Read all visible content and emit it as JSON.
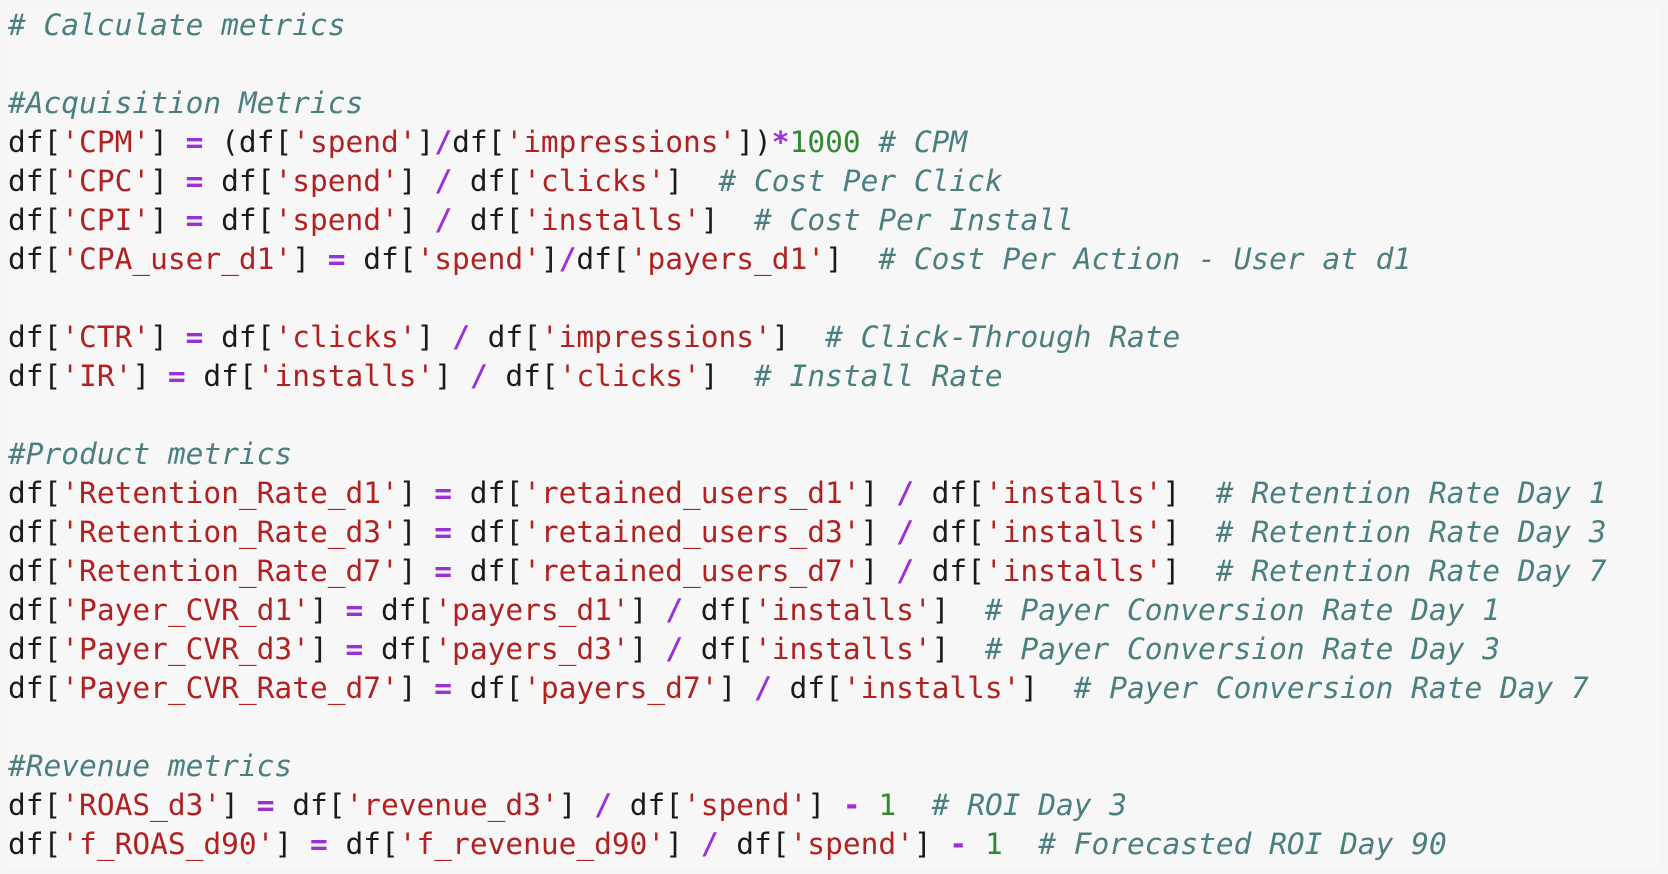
{
  "colors": {
    "background": "#f7f7f7",
    "plain": "#1a1a1a",
    "string": "#b22121",
    "operator": "#9d2fd6",
    "number": "#2f8a2f",
    "comment": "#4b7f7f"
  },
  "code_lines": [
    [
      {
        "t": "comment",
        "v": "# Calculate metrics"
      }
    ],
    [],
    [
      {
        "t": "comment",
        "v": "#Acquisition Metrics"
      }
    ],
    [
      {
        "t": "plain",
        "v": "df["
      },
      {
        "t": "str",
        "v": "'CPM'"
      },
      {
        "t": "plain",
        "v": "] "
      },
      {
        "t": "op",
        "v": "="
      },
      {
        "t": "plain",
        "v": " (df["
      },
      {
        "t": "str",
        "v": "'spend'"
      },
      {
        "t": "plain",
        "v": "]"
      },
      {
        "t": "op",
        "v": "/"
      },
      {
        "t": "plain",
        "v": "df["
      },
      {
        "t": "str",
        "v": "'impressions'"
      },
      {
        "t": "plain",
        "v": "])"
      },
      {
        "t": "op",
        "v": "*"
      },
      {
        "t": "num",
        "v": "1000"
      },
      {
        "t": "plain",
        "v": " "
      },
      {
        "t": "comment",
        "v": "# CPM"
      }
    ],
    [
      {
        "t": "plain",
        "v": "df["
      },
      {
        "t": "str",
        "v": "'CPC'"
      },
      {
        "t": "plain",
        "v": "] "
      },
      {
        "t": "op",
        "v": "="
      },
      {
        "t": "plain",
        "v": " df["
      },
      {
        "t": "str",
        "v": "'spend'"
      },
      {
        "t": "plain",
        "v": "] "
      },
      {
        "t": "op",
        "v": "/"
      },
      {
        "t": "plain",
        "v": " df["
      },
      {
        "t": "str",
        "v": "'clicks'"
      },
      {
        "t": "plain",
        "v": "]  "
      },
      {
        "t": "comment",
        "v": "# Cost Per Click"
      }
    ],
    [
      {
        "t": "plain",
        "v": "df["
      },
      {
        "t": "str",
        "v": "'CPI'"
      },
      {
        "t": "plain",
        "v": "] "
      },
      {
        "t": "op",
        "v": "="
      },
      {
        "t": "plain",
        "v": " df["
      },
      {
        "t": "str",
        "v": "'spend'"
      },
      {
        "t": "plain",
        "v": "] "
      },
      {
        "t": "op",
        "v": "/"
      },
      {
        "t": "plain",
        "v": " df["
      },
      {
        "t": "str",
        "v": "'installs'"
      },
      {
        "t": "plain",
        "v": "]  "
      },
      {
        "t": "comment",
        "v": "# Cost Per Install"
      }
    ],
    [
      {
        "t": "plain",
        "v": "df["
      },
      {
        "t": "str",
        "v": "'CPA_user_d1'"
      },
      {
        "t": "plain",
        "v": "] "
      },
      {
        "t": "op",
        "v": "="
      },
      {
        "t": "plain",
        "v": " df["
      },
      {
        "t": "str",
        "v": "'spend'"
      },
      {
        "t": "plain",
        "v": "]"
      },
      {
        "t": "op",
        "v": "/"
      },
      {
        "t": "plain",
        "v": "df["
      },
      {
        "t": "str",
        "v": "'payers_d1'"
      },
      {
        "t": "plain",
        "v": "]  "
      },
      {
        "t": "comment",
        "v": "# Cost Per Action - User at d1"
      }
    ],
    [],
    [
      {
        "t": "plain",
        "v": "df["
      },
      {
        "t": "str",
        "v": "'CTR'"
      },
      {
        "t": "plain",
        "v": "] "
      },
      {
        "t": "op",
        "v": "="
      },
      {
        "t": "plain",
        "v": " df["
      },
      {
        "t": "str",
        "v": "'clicks'"
      },
      {
        "t": "plain",
        "v": "] "
      },
      {
        "t": "op",
        "v": "/"
      },
      {
        "t": "plain",
        "v": " df["
      },
      {
        "t": "str",
        "v": "'impressions'"
      },
      {
        "t": "plain",
        "v": "]  "
      },
      {
        "t": "comment",
        "v": "# Click-Through Rate"
      }
    ],
    [
      {
        "t": "plain",
        "v": "df["
      },
      {
        "t": "str",
        "v": "'IR'"
      },
      {
        "t": "plain",
        "v": "] "
      },
      {
        "t": "op",
        "v": "="
      },
      {
        "t": "plain",
        "v": " df["
      },
      {
        "t": "str",
        "v": "'installs'"
      },
      {
        "t": "plain",
        "v": "] "
      },
      {
        "t": "op",
        "v": "/"
      },
      {
        "t": "plain",
        "v": " df["
      },
      {
        "t": "str",
        "v": "'clicks'"
      },
      {
        "t": "plain",
        "v": "]  "
      },
      {
        "t": "comment",
        "v": "# Install Rate"
      }
    ],
    [],
    [
      {
        "t": "comment",
        "v": "#Product metrics"
      }
    ],
    [
      {
        "t": "plain",
        "v": "df["
      },
      {
        "t": "str",
        "v": "'Retention_Rate_d1'"
      },
      {
        "t": "plain",
        "v": "] "
      },
      {
        "t": "op",
        "v": "="
      },
      {
        "t": "plain",
        "v": " df["
      },
      {
        "t": "str",
        "v": "'retained_users_d1'"
      },
      {
        "t": "plain",
        "v": "] "
      },
      {
        "t": "op",
        "v": "/"
      },
      {
        "t": "plain",
        "v": " df["
      },
      {
        "t": "str",
        "v": "'installs'"
      },
      {
        "t": "plain",
        "v": "]  "
      },
      {
        "t": "comment",
        "v": "# Retention Rate Day 1"
      }
    ],
    [
      {
        "t": "plain",
        "v": "df["
      },
      {
        "t": "str",
        "v": "'Retention_Rate_d3'"
      },
      {
        "t": "plain",
        "v": "] "
      },
      {
        "t": "op",
        "v": "="
      },
      {
        "t": "plain",
        "v": " df["
      },
      {
        "t": "str",
        "v": "'retained_users_d3'"
      },
      {
        "t": "plain",
        "v": "] "
      },
      {
        "t": "op",
        "v": "/"
      },
      {
        "t": "plain",
        "v": " df["
      },
      {
        "t": "str",
        "v": "'installs'"
      },
      {
        "t": "plain",
        "v": "]  "
      },
      {
        "t": "comment",
        "v": "# Retention Rate Day 3"
      }
    ],
    [
      {
        "t": "plain",
        "v": "df["
      },
      {
        "t": "str",
        "v": "'Retention_Rate_d7'"
      },
      {
        "t": "plain",
        "v": "] "
      },
      {
        "t": "op",
        "v": "="
      },
      {
        "t": "plain",
        "v": " df["
      },
      {
        "t": "str",
        "v": "'retained_users_d7'"
      },
      {
        "t": "plain",
        "v": "] "
      },
      {
        "t": "op",
        "v": "/"
      },
      {
        "t": "plain",
        "v": " df["
      },
      {
        "t": "str",
        "v": "'installs'"
      },
      {
        "t": "plain",
        "v": "]  "
      },
      {
        "t": "comment",
        "v": "# Retention Rate Day 7"
      }
    ],
    [
      {
        "t": "plain",
        "v": "df["
      },
      {
        "t": "str",
        "v": "'Payer_CVR_d1'"
      },
      {
        "t": "plain",
        "v": "] "
      },
      {
        "t": "op",
        "v": "="
      },
      {
        "t": "plain",
        "v": " df["
      },
      {
        "t": "str",
        "v": "'payers_d1'"
      },
      {
        "t": "plain",
        "v": "] "
      },
      {
        "t": "op",
        "v": "/"
      },
      {
        "t": "plain",
        "v": " df["
      },
      {
        "t": "str",
        "v": "'installs'"
      },
      {
        "t": "plain",
        "v": "]  "
      },
      {
        "t": "comment",
        "v": "# Payer Conversion Rate Day 1"
      }
    ],
    [
      {
        "t": "plain",
        "v": "df["
      },
      {
        "t": "str",
        "v": "'Payer_CVR_d3'"
      },
      {
        "t": "plain",
        "v": "] "
      },
      {
        "t": "op",
        "v": "="
      },
      {
        "t": "plain",
        "v": " df["
      },
      {
        "t": "str",
        "v": "'payers_d3'"
      },
      {
        "t": "plain",
        "v": "] "
      },
      {
        "t": "op",
        "v": "/"
      },
      {
        "t": "plain",
        "v": " df["
      },
      {
        "t": "str",
        "v": "'installs'"
      },
      {
        "t": "plain",
        "v": "]  "
      },
      {
        "t": "comment",
        "v": "# Payer Conversion Rate Day 3"
      }
    ],
    [
      {
        "t": "plain",
        "v": "df["
      },
      {
        "t": "str",
        "v": "'Payer_CVR_Rate_d7'"
      },
      {
        "t": "plain",
        "v": "] "
      },
      {
        "t": "op",
        "v": "="
      },
      {
        "t": "plain",
        "v": " df["
      },
      {
        "t": "str",
        "v": "'payers_d7'"
      },
      {
        "t": "plain",
        "v": "] "
      },
      {
        "t": "op",
        "v": "/"
      },
      {
        "t": "plain",
        "v": " df["
      },
      {
        "t": "str",
        "v": "'installs'"
      },
      {
        "t": "plain",
        "v": "]  "
      },
      {
        "t": "comment",
        "v": "# Payer Conversion Rate Day 7"
      }
    ],
    [],
    [
      {
        "t": "comment",
        "v": "#Revenue metrics"
      }
    ],
    [
      {
        "t": "plain",
        "v": "df["
      },
      {
        "t": "str",
        "v": "'ROAS_d3'"
      },
      {
        "t": "plain",
        "v": "] "
      },
      {
        "t": "op",
        "v": "="
      },
      {
        "t": "plain",
        "v": " df["
      },
      {
        "t": "str",
        "v": "'revenue_d3'"
      },
      {
        "t": "plain",
        "v": "] "
      },
      {
        "t": "op",
        "v": "/"
      },
      {
        "t": "plain",
        "v": " df["
      },
      {
        "t": "str",
        "v": "'spend'"
      },
      {
        "t": "plain",
        "v": "] "
      },
      {
        "t": "op",
        "v": "-"
      },
      {
        "t": "plain",
        "v": " "
      },
      {
        "t": "num",
        "v": "1"
      },
      {
        "t": "plain",
        "v": "  "
      },
      {
        "t": "comment",
        "v": "# ROI Day 3"
      }
    ],
    [
      {
        "t": "plain",
        "v": "df["
      },
      {
        "t": "str",
        "v": "'f_ROAS_d90'"
      },
      {
        "t": "plain",
        "v": "] "
      },
      {
        "t": "op",
        "v": "="
      },
      {
        "t": "plain",
        "v": " df["
      },
      {
        "t": "str",
        "v": "'f_revenue_d90'"
      },
      {
        "t": "plain",
        "v": "] "
      },
      {
        "t": "op",
        "v": "/"
      },
      {
        "t": "plain",
        "v": " df["
      },
      {
        "t": "str",
        "v": "'spend'"
      },
      {
        "t": "plain",
        "v": "] "
      },
      {
        "t": "op",
        "v": "-"
      },
      {
        "t": "plain",
        "v": " "
      },
      {
        "t": "num",
        "v": "1"
      },
      {
        "t": "plain",
        "v": "  "
      },
      {
        "t": "comment",
        "v": "# Forecasted ROI Day 90"
      }
    ]
  ]
}
